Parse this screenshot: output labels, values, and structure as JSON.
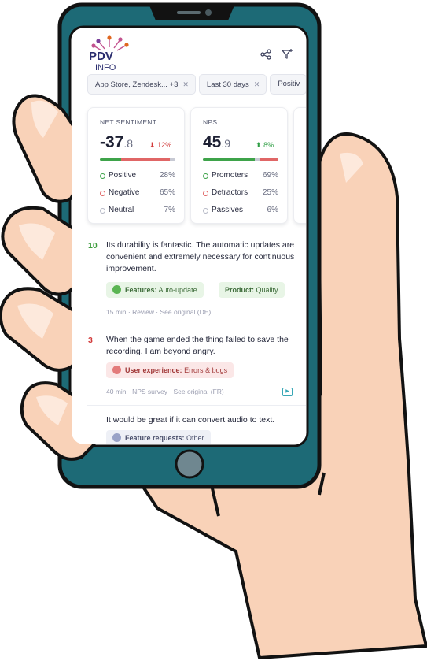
{
  "app": {
    "logo": {
      "line1": "PDV",
      "line2": "INFO"
    },
    "header_icons": [
      "share-icon",
      "filter-icon"
    ]
  },
  "filters": [
    {
      "label": "App Store, Zendesk... +3"
    },
    {
      "label": "Last 30 days"
    },
    {
      "label": "Positiv"
    }
  ],
  "cards": {
    "sentiment": {
      "title": "NET SENTIMENT",
      "value_int": "-37",
      "value_dec": ".8",
      "delta": "12%",
      "delta_direction": "down",
      "rows": [
        {
          "label": "Positive",
          "pct": "28%",
          "color": "#3ea34a"
        },
        {
          "label": "Negative",
          "pct": "65%",
          "color": "#e06666"
        },
        {
          "label": "Neutral",
          "pct": "7%",
          "color": "#b7bac7"
        }
      ]
    },
    "nps": {
      "title": "NPS",
      "value_int": "45",
      "value_dec": ".9",
      "delta": "8%",
      "delta_direction": "up",
      "rows": [
        {
          "label": "Promoters",
          "pct": "69%",
          "color": "#3ea34a"
        },
        {
          "label": "Detractors",
          "pct": "25%",
          "color": "#e06666"
        },
        {
          "label": "Passives",
          "pct": "6%",
          "color": "#b7bac7"
        }
      ]
    }
  },
  "feed": [
    {
      "score": "10",
      "text": "Its durability is fantastic. The automatic updates are convenient and extremely necessary for continuous improvement.",
      "tags": [
        {
          "category": "Features:",
          "value": "Auto-update",
          "tone": "green"
        },
        {
          "category": "Product:",
          "value": "Quality",
          "tone": "green"
        }
      ],
      "meta": "15 min  ·  Review  ·  See original (DE)"
    },
    {
      "score": "3",
      "text": "When the game ended the thing failed to save the recording. I am beyond angry.",
      "tags": [
        {
          "category": "User experience:",
          "value": "Errors & bugs",
          "tone": "red"
        }
      ],
      "meta": "40 min  ·  NPS survey  ·  See original (FR)"
    },
    {
      "score": "",
      "text": "It would be great if it can convert audio to text.",
      "tags": [
        {
          "category": "Feature requests:",
          "value": "Other",
          "tone": "blue"
        }
      ],
      "meta": ""
    }
  ],
  "colors": {
    "phone_body": "#1d6a76",
    "hand": "#f9d2b8",
    "outline": "#121212",
    "home_button": "#6f8790"
  }
}
